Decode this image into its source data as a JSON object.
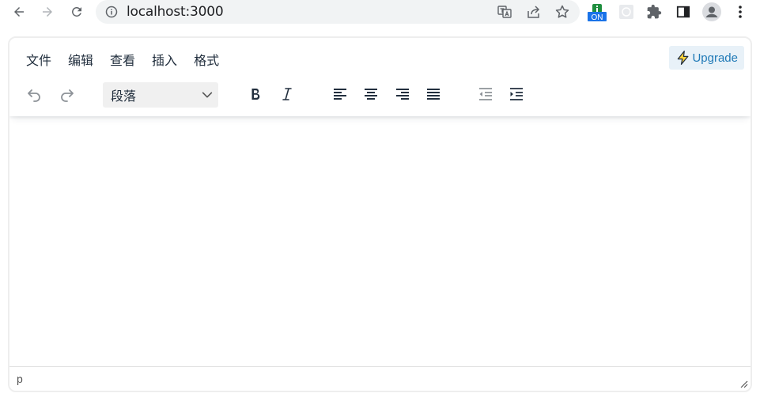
{
  "browser": {
    "url": "localhost:3000",
    "extension_badge": "ON"
  },
  "editor": {
    "menu": [
      {
        "label": "文件"
      },
      {
        "label": "编辑"
      },
      {
        "label": "查看"
      },
      {
        "label": "插入"
      },
      {
        "label": "格式"
      }
    ],
    "upgrade_label": "Upgrade",
    "block_format": {
      "selected": "段落"
    },
    "status_path": "p"
  },
  "colors": {
    "accent": "#207ab7",
    "upgrade_bg": "#e8f1f8",
    "icon": "#222f3e",
    "icon_disabled": "#8d9298"
  }
}
